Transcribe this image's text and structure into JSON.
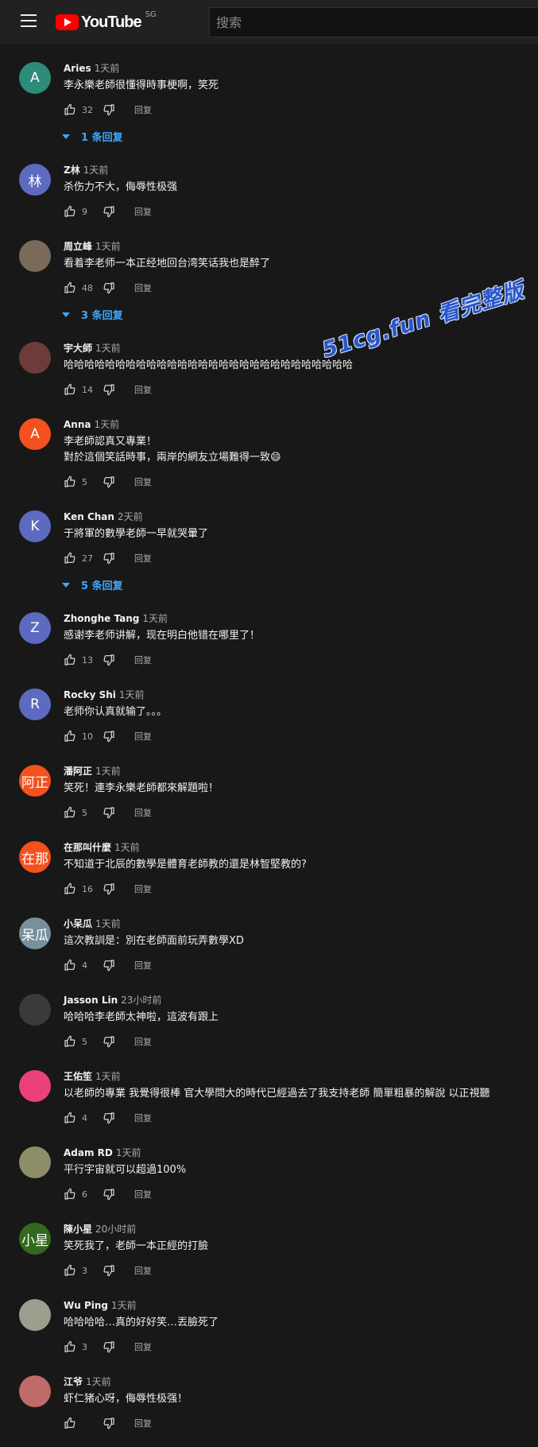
{
  "header": {
    "logo_text": "YouTube",
    "region": "SG",
    "search_placeholder": "搜索"
  },
  "watermark": "51cg.fun 看完整版",
  "reply_label": "回复",
  "comments": [
    {
      "author": "Aries",
      "time": "1天前",
      "text": "李永樂老師很懂得時事梗啊，笑死",
      "likes": "32",
      "avatar_letter": "A",
      "avatar_color": "#2e8b7a",
      "replies": "1 条回复"
    },
    {
      "author": "Z林",
      "time": "1天前",
      "text": "杀伤力不大，侮辱性极强",
      "likes": "9",
      "avatar_letter": "林",
      "avatar_color": "#5c6bc0"
    },
    {
      "author": "周立峰",
      "time": "1天前",
      "text": "看着李老师一本正经地回台湾笑话我也是醉了",
      "likes": "48",
      "avatar_letter": "",
      "avatar_color": "#7a6a5a",
      "replies": "3 条回复"
    },
    {
      "author": "宇大師",
      "time": "1天前",
      "text": "哈哈哈哈哈哈哈哈哈哈哈哈哈哈哈哈哈哈哈哈哈哈哈哈哈哈哈哈",
      "likes": "14",
      "avatar_letter": "",
      "avatar_color": "#6e3b3b"
    },
    {
      "author": "Anna",
      "time": "1天前",
      "text": "李老師認真又專業！\n對於這個笑話時事，兩岸的網友立場難得一致😄",
      "likes": "5",
      "avatar_letter": "A",
      "avatar_color": "#f4511e"
    },
    {
      "author": "Ken Chan",
      "time": "2天前",
      "text": "于將軍的數學老師一早就哭暈了",
      "likes": "27",
      "avatar_letter": "K",
      "avatar_color": "#5c6bc0",
      "replies": "5 条回复"
    },
    {
      "author": "Zhonghe Tang",
      "time": "1天前",
      "text": "感谢李老师讲解，现在明白他错在哪里了！",
      "likes": "13",
      "avatar_letter": "Z",
      "avatar_color": "#5c6bc0"
    },
    {
      "author": "Rocky Shi",
      "time": "1天前",
      "text": "老师你认真就输了。。。",
      "likes": "10",
      "avatar_letter": "R",
      "avatar_color": "#5c6bc0"
    },
    {
      "author": "潘阿正",
      "time": "1天前",
      "text": "笑死！連李永樂老師都來解題啦！",
      "likes": "5",
      "avatar_letter": "阿正",
      "avatar_color": "#f4511e"
    },
    {
      "author": "在那叫什麼",
      "time": "1天前",
      "text": "不知道于北辰的數學是體育老師教的還是林智堅教的?",
      "likes": "16",
      "avatar_letter": "在那",
      "avatar_color": "#f4511e"
    },
    {
      "author": "小呆瓜",
      "time": "1天前",
      "text": "這次教訓是：別在老師面前玩弄數學XD",
      "likes": "4",
      "avatar_letter": "呆瓜",
      "avatar_color": "#78909c"
    },
    {
      "author": "Jasson Lin",
      "time": "23小时前",
      "text": "哈哈哈李老師太神啦，這波有跟上",
      "likes": "5",
      "avatar_letter": "",
      "avatar_color": "#3a3a3a"
    },
    {
      "author": "王佑笙",
      "time": "1天前",
      "text": "以老師的專業 我覺得很棒 官大學問大的時代已經過去了我支持老師 簡單粗暴的解說 以正視聽",
      "likes": "4",
      "avatar_letter": "",
      "avatar_color": "#ec407a"
    },
    {
      "author": "Adam RD",
      "time": "1天前",
      "text": "平行宇宙就可以超過100%",
      "likes": "6",
      "avatar_letter": "",
      "avatar_color": "#8d8d6a"
    },
    {
      "author": "陳小星",
      "time": "20小时前",
      "text": "笑死我了，老師一本正經的打臉",
      "likes": "3",
      "avatar_letter": "小星",
      "avatar_color": "#33691e"
    },
    {
      "author": "Wu Ping",
      "time": "1天前",
      "text": "哈哈哈哈…真的好好笑…丟臉死了",
      "likes": "3",
      "avatar_letter": "",
      "avatar_color": "#9e9e8e"
    },
    {
      "author": "江爷",
      "time": "1天前",
      "text": "虾仁猪心呀，侮辱性极强！",
      "likes": "",
      "avatar_letter": "",
      "avatar_color": "#c06a6a"
    }
  ]
}
